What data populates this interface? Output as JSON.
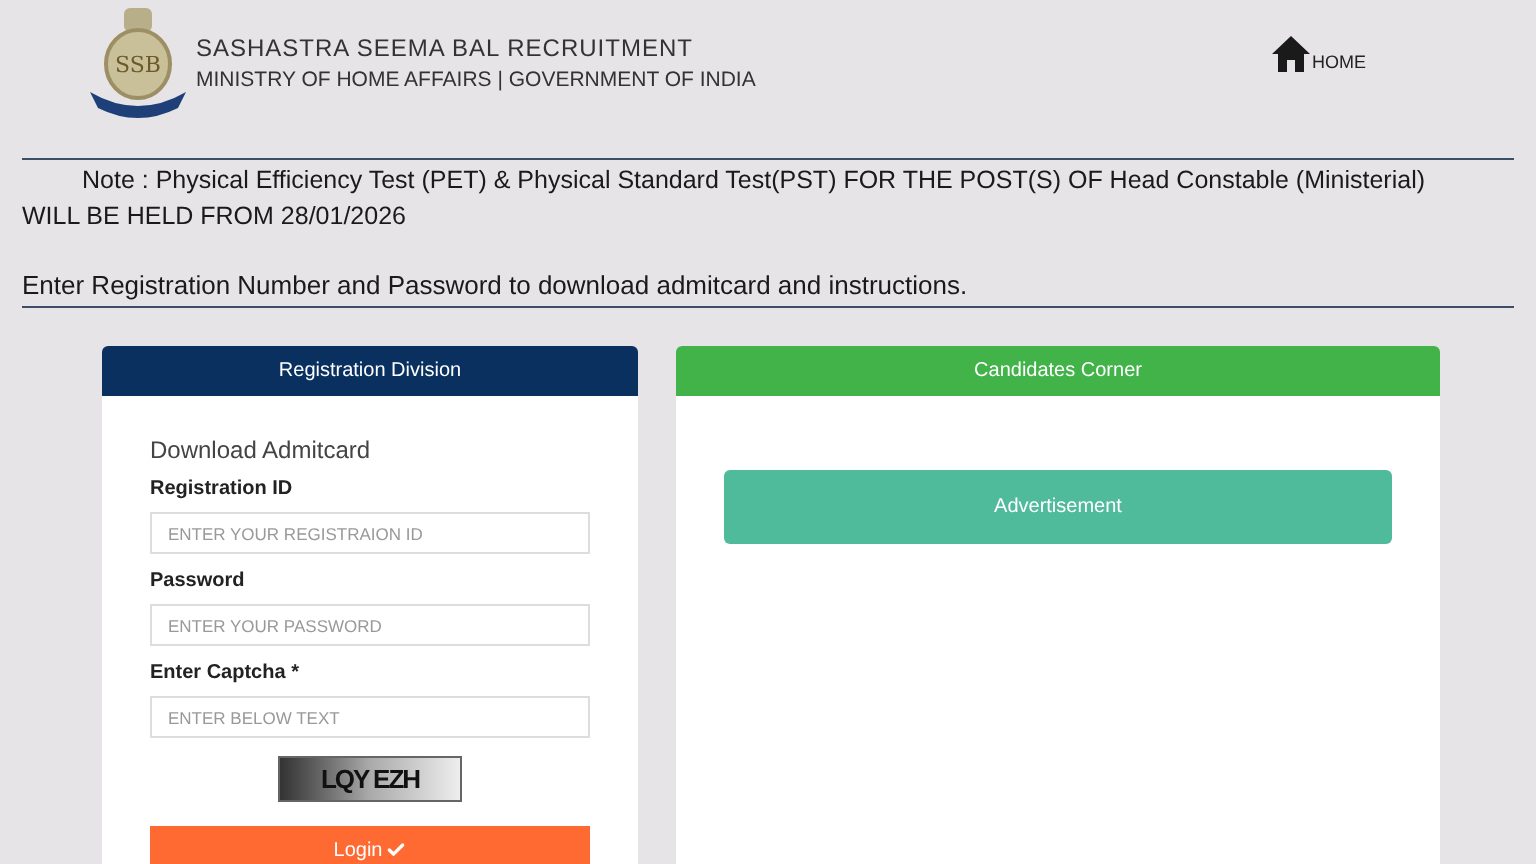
{
  "header": {
    "title": "SASHASTRA SEEMA BAL RECRUITMENT",
    "subtitle": "MINISTRY OF HOME AFFAIRS | GOVERNMENT OF INDIA",
    "logo_text": "SSB",
    "nav": [
      {
        "label": "HOME"
      }
    ]
  },
  "note": {
    "line1": "Note : Physical Efficiency Test (PET) & Physical Standard Test(PST) FOR THE POST(S) OF Head Constable (Ministerial)",
    "line2": "WILL BE HELD FROM 28/01/2026"
  },
  "instruction": "Enter Registration Number and Password to download admitcard and instructions.",
  "registration_panel": {
    "title": "Registration Division",
    "form_title": "Download Admitcard",
    "fields": [
      {
        "label": "Registration ID",
        "placeholder": "ENTER YOUR REGISTRAION ID"
      },
      {
        "label": "Password",
        "placeholder": "ENTER YOUR PASSWORD"
      },
      {
        "label": "Enter Captcha *",
        "placeholder": "ENTER BELOW TEXT"
      }
    ],
    "captcha": "LQY EZH",
    "button": "Login"
  },
  "candidates_panel": {
    "title": "Candidates Corner",
    "banner": "Advertisement"
  }
}
